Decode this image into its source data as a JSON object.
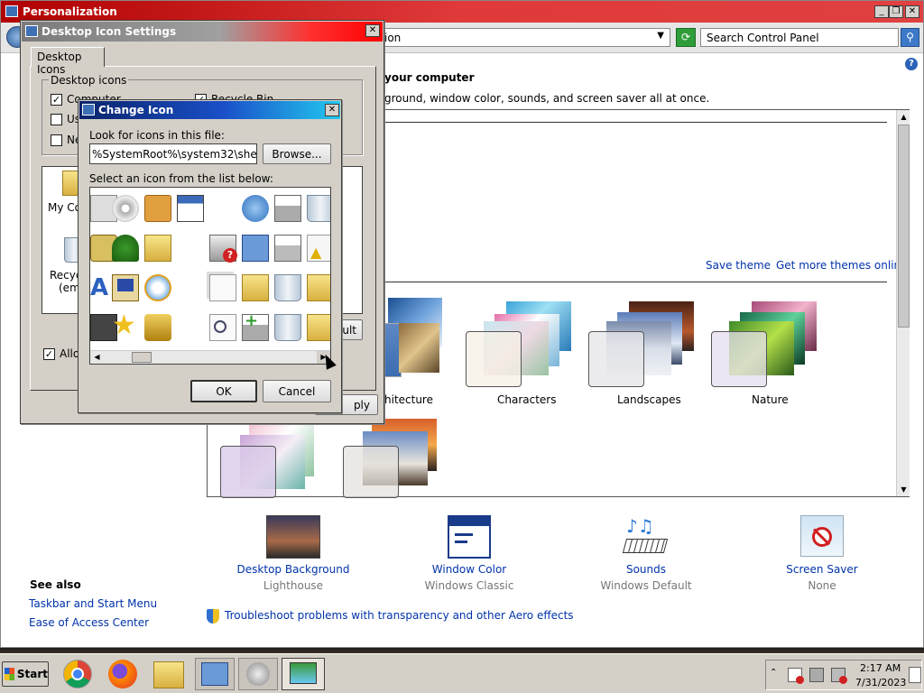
{
  "personalization": {
    "title": "Personalization",
    "address_fragment": "ion",
    "search_placeholder": "Search Control Panel",
    "heading": "your computer",
    "subheading": "ground, window color, sounds, and screen saver all at once.",
    "save_theme": "Save theme",
    "get_more_themes": "Get more themes online",
    "themes": [
      {
        "label": "hitecture"
      },
      {
        "label": "Characters"
      },
      {
        "label": "Landscapes"
      },
      {
        "label": "Nature"
      }
    ],
    "bottom_items": [
      {
        "label": "Desktop Background",
        "value": "Lighthouse",
        "icon": "desktop-background-icon"
      },
      {
        "label": "Window Color",
        "value": "Windows Classic",
        "icon": "window-color-icon"
      },
      {
        "label": "Sounds",
        "value": "Windows Default",
        "icon": "sounds-icon"
      },
      {
        "label": "Screen Saver",
        "value": "None",
        "icon": "screen-saver-icon"
      }
    ],
    "see_also": {
      "title": "See also",
      "links": [
        "Taskbar and Start Menu",
        "Ease of Access Center"
      ]
    },
    "troubleshoot": "Troubleshoot problems with transparency and other Aero effects"
  },
  "desktop_icon_settings": {
    "title": "Desktop Icon Settings",
    "tab": "Desktop Icons",
    "group_label": "Desktop icons",
    "checkboxes": [
      {
        "label": "Computer",
        "checked": true
      },
      {
        "label": "Recycle Bin",
        "checked": true
      },
      {
        "label": "Us",
        "checked": false
      },
      {
        "label": "Ne",
        "checked": false
      }
    ],
    "icons": [
      {
        "label": "My Co"
      },
      {
        "label": "Recyc"
      },
      {
        "label": "(emp"
      }
    ],
    "allow_label": "Allov",
    "allow_checked": true,
    "restore_fragment": "ault",
    "apply_fragment": "ply"
  },
  "change_icon": {
    "title": "Change Icon",
    "look_label": "Look for icons in this file:",
    "file_value": "%SystemRoot%\\system32\\shell32.dll",
    "browse": "Browse...",
    "select_label": "Select an icon from the list below:",
    "ok": "OK",
    "cancel": "Cancel"
  },
  "taskbar": {
    "start": "Start",
    "time": "2:17 AM",
    "date": "7/31/2023"
  }
}
